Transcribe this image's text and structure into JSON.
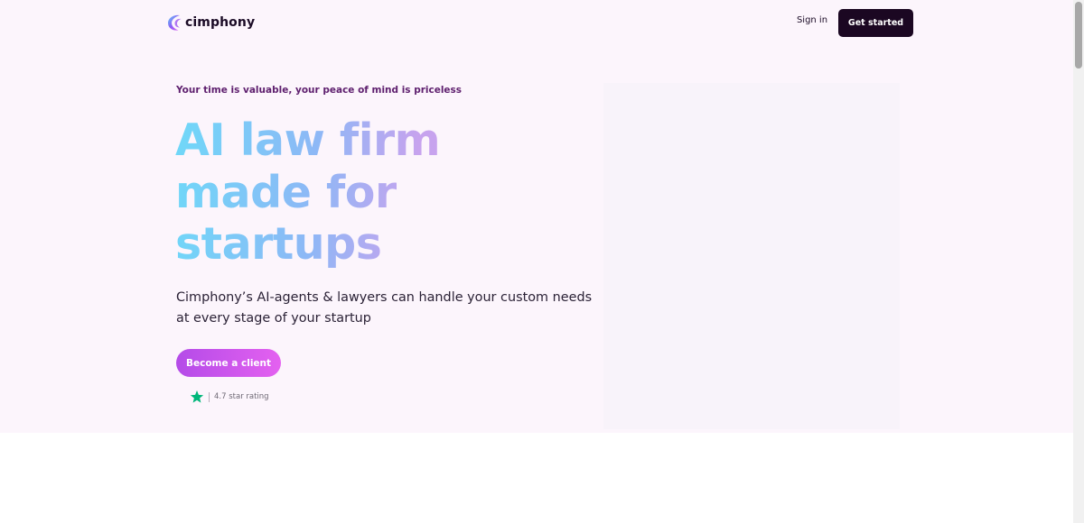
{
  "header": {
    "logo_text": "cimphony",
    "sign_in": "Sign in",
    "get_started": "Get started"
  },
  "hero": {
    "tagline": "Your time is valuable, your peace of mind is priceless",
    "headline_lines": [
      "AI law firm",
      "made for",
      "startups"
    ],
    "subhead": "Cimphony’s AI-agents & lawyers can handle your custom needs at every stage of your startup",
    "cta": "Become a client",
    "rating_text": "4.7 star rating"
  },
  "colors": {
    "hero_background": "#fcf5fc",
    "primary_dark": "#1b0722",
    "tagline": "#5e1f6e",
    "headline_gradient": [
      "#6fd8f8",
      "#c7a3ee"
    ],
    "cta_gradient": [
      "#b44be8",
      "#e461f0"
    ],
    "star": "#00b67a"
  },
  "icons": {
    "logo": "cimphony-logo-icon",
    "rating_star": "star-icon"
  }
}
